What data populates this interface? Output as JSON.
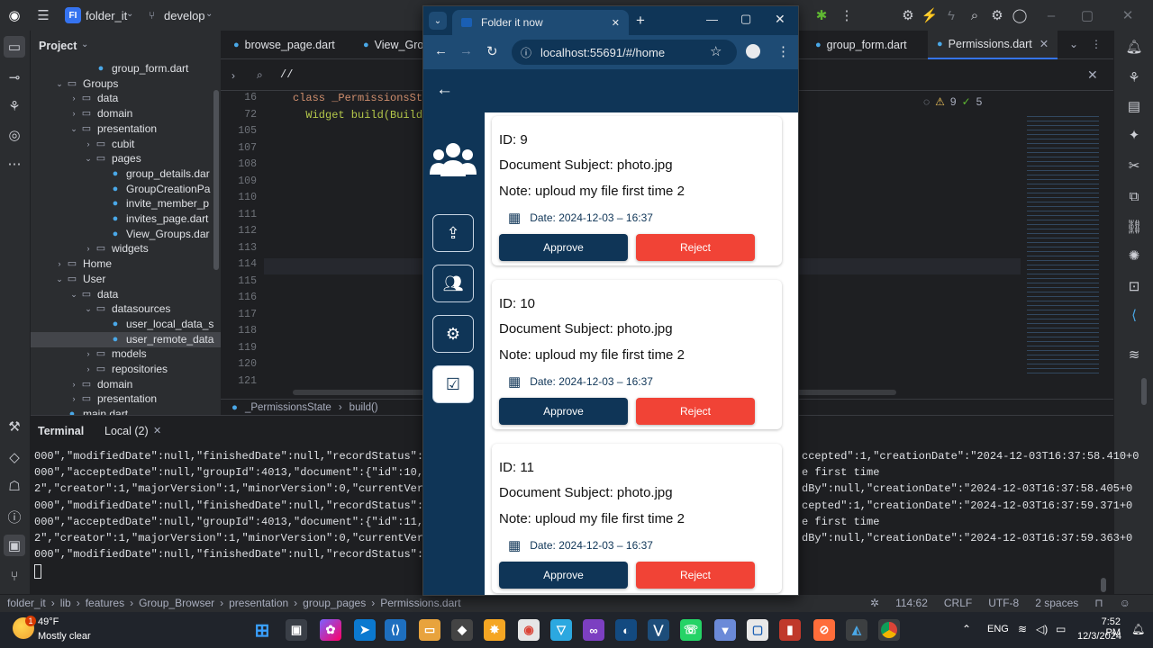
{
  "ide": {
    "project_badge": "FI",
    "project_name": "folder_it",
    "branch": "develop",
    "panel_title": "Project",
    "tree": [
      {
        "label": "group_form.dart",
        "type": "dart",
        "indent": 5
      },
      {
        "label": "Groups",
        "type": "folder",
        "indent": 3,
        "arrow": "v"
      },
      {
        "label": "data",
        "type": "folder",
        "indent": 4,
        "arrow": ">"
      },
      {
        "label": "domain",
        "type": "folder",
        "indent": 4,
        "arrow": ">"
      },
      {
        "label": "presentation",
        "type": "folder",
        "indent": 4,
        "arrow": "v"
      },
      {
        "label": "cubit",
        "type": "folder",
        "indent": 5,
        "arrow": ">"
      },
      {
        "label": "pages",
        "type": "folder",
        "indent": 5,
        "arrow": "v"
      },
      {
        "label": "group_details.dar",
        "type": "dart",
        "indent": 6
      },
      {
        "label": "GroupCreationPa",
        "type": "dart",
        "indent": 6
      },
      {
        "label": "invite_member_p",
        "type": "dart",
        "indent": 6
      },
      {
        "label": "invites_page.dart",
        "type": "dart",
        "indent": 6
      },
      {
        "label": "View_Groups.dar",
        "type": "dart",
        "indent": 6
      },
      {
        "label": "widgets",
        "type": "folder",
        "indent": 5,
        "arrow": ">"
      },
      {
        "label": "Home",
        "type": "folder",
        "indent": 3,
        "arrow": ">"
      },
      {
        "label": "User",
        "type": "folder",
        "indent": 3,
        "arrow": "v"
      },
      {
        "label": "data",
        "type": "folder",
        "indent": 4,
        "arrow": "v"
      },
      {
        "label": "datasources",
        "type": "folder",
        "indent": 5,
        "arrow": "v"
      },
      {
        "label": "user_local_data_s",
        "type": "dart",
        "indent": 6
      },
      {
        "label": "user_remote_data",
        "type": "dart",
        "indent": 6,
        "selected": true
      },
      {
        "label": "models",
        "type": "folder",
        "indent": 5,
        "arrow": ">"
      },
      {
        "label": "repositories",
        "type": "folder",
        "indent": 5,
        "arrow": ">"
      },
      {
        "label": "domain",
        "type": "folder",
        "indent": 4,
        "arrow": ">"
      },
      {
        "label": "presentation",
        "type": "folder",
        "indent": 4,
        "arrow": ">"
      },
      {
        "label": "main.dart",
        "type": "dart",
        "indent": 3
      }
    ],
    "tabs": [
      {
        "label": "browse_page.dart"
      },
      {
        "label": "View_Grou"
      },
      {
        "label": "group_form.dart"
      },
      {
        "label": "Permissions.dart",
        "active": true
      }
    ],
    "search_text": "//",
    "code_lines": [
      {
        "n": "16",
        "text": "class _PermissionsStat"
      },
      {
        "n": "72",
        "text": "  Widget build(BuildCo"
      },
      {
        "n": "105",
        "text": ""
      },
      {
        "n": "107",
        "text": ""
      },
      {
        "n": "108",
        "text": ""
      },
      {
        "n": "109",
        "text": ""
      },
      {
        "n": "110",
        "text": ""
      },
      {
        "n": "111",
        "text": ""
      },
      {
        "n": "112",
        "text": ""
      },
      {
        "n": "113",
        "text": ""
      },
      {
        "n": "114",
        "text": ""
      },
      {
        "n": "115",
        "text": ""
      },
      {
        "n": "116",
        "text": ""
      },
      {
        "n": "117",
        "text": ""
      },
      {
        "n": "118",
        "text": ""
      },
      {
        "n": "119",
        "text": ""
      },
      {
        "n": "120",
        "text": ""
      },
      {
        "n": "121",
        "text": ""
      }
    ],
    "warnings": "9",
    "weak_warnings": "5",
    "breadcrumb_code": [
      "_PermissionsState",
      "build()"
    ],
    "terminal_tabs": [
      "Terminal",
      "Local (2)"
    ],
    "terminal_lines_left": [
      "000\",\"modifiedDate\":null,\"finishedDate\":null,\"recordStatus\":true,",
      "000\",\"acceptedDate\":null,\"groupId\":4013,\"document\":{\"id\":10,\"subj",
      "2\",\"creator\":1,\"majorVersion\":1,\"minorVersion\":0,\"currentVersion\"",
      "000\",\"modifiedDate\":null,\"finishedDate\":null,\"recordStatus\":true,",
      "000\",\"acceptedDate\":null,\"groupId\":4013,\"document\":{\"id\":11,\"subj",
      "2\",\"creator\":1,\"majorVersion\":1,\"minorVersion\":0,\"currentVersion\"",
      "000\",\"modifiedDate\":null,\"finishedDate\":null,\"recordStatus\":true,"
    ],
    "terminal_lines_right": [
      "ccepted\":1,\"creationDate\":\"2024-12-03T16:37:58.410+0",
      "e first time",
      "dBy\":null,\"creationDate\":\"2024-12-03T16:37:58.405+0",
      "cepted\":1,\"creationDate\":\"2024-12-03T16:37:59.371+0",
      "e first time",
      "dBy\":null,\"creationDate\":\"2024-12-03T16:37:59.363+0",
      ""
    ],
    "status_path": [
      "folder_it",
      "lib",
      "features",
      "Group_Browser",
      "presentation",
      "group_pages",
      "Permissions.dart"
    ],
    "status_right": {
      "position": "114:62",
      "line_sep": "CRLF",
      "encoding": "UTF-8",
      "indent": "2 spaces"
    }
  },
  "browser": {
    "tab_title": "Folder it now",
    "url": "localhost:55691/#/home",
    "cards": [
      {
        "id": "ID: 9",
        "subject": "Document Subject: photo.jpg",
        "note": "Note: uploud my file first time 2",
        "date": "Date: 2024-12-03 – 16:37",
        "approve": "Approve",
        "reject": "Reject"
      },
      {
        "id": "ID: 10",
        "subject": "Document Subject: photo.jpg",
        "note": "Note: uploud my file first time 2",
        "date": "Date: 2024-12-03 – 16:37",
        "approve": "Approve",
        "reject": "Reject"
      },
      {
        "id": "ID: 11",
        "subject": "Document Subject: photo.jpg",
        "note": "Note: uploud my file first time 2",
        "date": "Date: 2024-12-03 – 16:37",
        "approve": "Approve",
        "reject": "Reject"
      }
    ]
  },
  "taskbar": {
    "weather_temp": "49°F",
    "weather_desc": "Mostly clear",
    "lang": "ENG",
    "time": "7:52 PM",
    "date": "12/3/2024",
    "notif_badge": "1"
  },
  "colors": {
    "accent": "#0f3557",
    "reject": "#f14336",
    "ide_bg": "#1e1f22",
    "ide_panel": "#2b2d30"
  }
}
